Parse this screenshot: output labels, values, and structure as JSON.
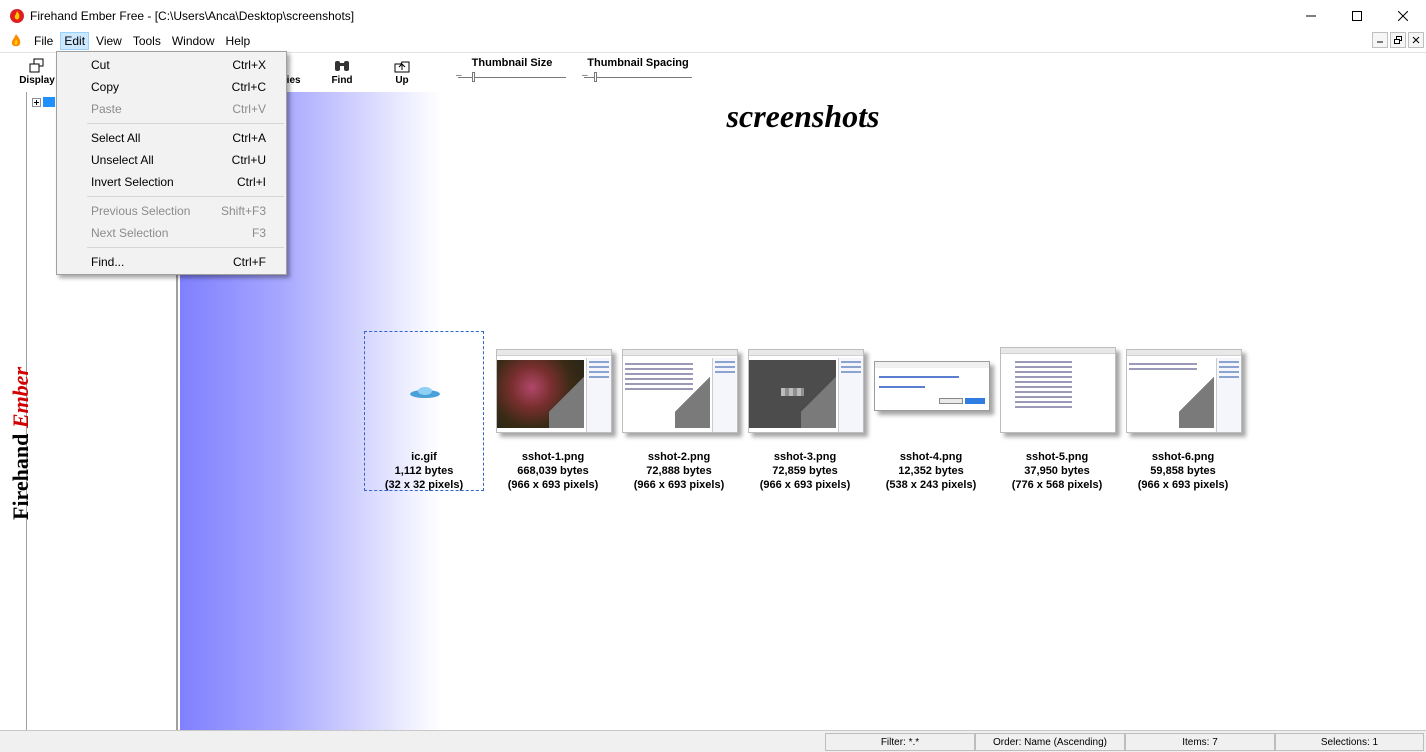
{
  "window": {
    "title": "Firehand Ember Free - [C:\\Users\\Anca\\Desktop\\screenshots]"
  },
  "menubar": {
    "items": [
      "File",
      "Edit",
      "View",
      "Tools",
      "Window",
      "Help"
    ],
    "active": "Edit"
  },
  "toolbar": {
    "display_label": "Display",
    "properties_label": "rties",
    "find_label": "Find",
    "up_label": "Up",
    "thumb_size_label": "Thumbnail Size",
    "thumb_spacing_label": "Thumbnail Spacing"
  },
  "brand": {
    "fire": "Firehand",
    "ember": "Ember"
  },
  "edit_menu": {
    "items": [
      {
        "label": "Cut",
        "shortcut": "Ctrl+X",
        "enabled": true
      },
      {
        "label": "Copy",
        "shortcut": "Ctrl+C",
        "enabled": true
      },
      {
        "label": "Paste",
        "shortcut": "Ctrl+V",
        "enabled": false
      },
      {
        "label": "Select All",
        "shortcut": "Ctrl+A",
        "enabled": true
      },
      {
        "label": "Unselect All",
        "shortcut": "Ctrl+U",
        "enabled": true
      },
      {
        "label": "Invert Selection",
        "shortcut": "Ctrl+I",
        "enabled": true
      },
      {
        "label": "Previous Selection",
        "shortcut": "Shift+F3",
        "enabled": false
      },
      {
        "label": "Next Selection",
        "shortcut": "F3",
        "enabled": false
      },
      {
        "label": "Find...",
        "shortcut": "Ctrl+F",
        "enabled": true
      }
    ]
  },
  "content": {
    "folder_title": "screenshots",
    "thumbnails": [
      {
        "name": "ic.gif",
        "size": "1,112 bytes",
        "dims": "(32 x 32 pixels)",
        "kind": "icon",
        "selected": true
      },
      {
        "name": "sshot-1.png",
        "size": "668,039 bytes",
        "dims": "(966 x 693 pixels)",
        "kind": "photo"
      },
      {
        "name": "sshot-2.png",
        "size": "72,888 bytes",
        "dims": "(966 x 693 pixels)",
        "kind": "light"
      },
      {
        "name": "sshot-3.png",
        "size": "72,859 bytes",
        "dims": "(966 x 693 pixels)",
        "kind": "dark"
      },
      {
        "name": "sshot-4.png",
        "size": "12,352 bytes",
        "dims": "(538 x 243 pixels)",
        "kind": "dialog"
      },
      {
        "name": "sshot-5.png",
        "size": "37,950 bytes",
        "dims": "(776 x 568 pixels)",
        "kind": "list"
      },
      {
        "name": "sshot-6.png",
        "size": "59,858 bytes",
        "dims": "(966 x 693 pixels)",
        "kind": "light"
      }
    ]
  },
  "statusbar": {
    "filter": "Filter: *.*",
    "order": "Order: Name (Ascending)",
    "items": "Items: 7",
    "selections": "Selections: 1"
  }
}
